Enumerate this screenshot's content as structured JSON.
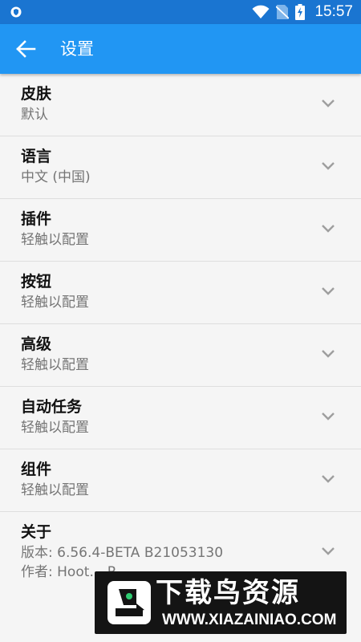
{
  "status_bar": {
    "time": "15:57",
    "icons": [
      "shield-icon",
      "wifi-icon",
      "no-sim-icon",
      "battery-charging-icon"
    ]
  },
  "app_bar": {
    "title": "设置",
    "back_icon": "arrow-back-icon"
  },
  "settings": {
    "items": [
      {
        "title": "皮肤",
        "subtitle": "默认"
      },
      {
        "title": "语言",
        "subtitle": "中文 (中国)"
      },
      {
        "title": "插件",
        "subtitle": "轻触以配置"
      },
      {
        "title": "按钮",
        "subtitle": "轻触以配置"
      },
      {
        "title": "高级",
        "subtitle": "轻触以配置"
      },
      {
        "title": "自动任务",
        "subtitle": "轻触以配置"
      },
      {
        "title": "组件",
        "subtitle": "轻触以配置"
      },
      {
        "title": "关于",
        "subtitle": "版本: 6.56.4-BETA  B21053130",
        "subtitle2": "作者: Hoot… R…"
      }
    ]
  },
  "watermark": {
    "title": "下载鸟资源",
    "url": "WWW.XIAZAINIAO.COM"
  },
  "colors": {
    "status_bar": "#1a75d1",
    "app_bar": "#2196f3",
    "background": "#f5f5f5",
    "divider": "#dedede"
  }
}
